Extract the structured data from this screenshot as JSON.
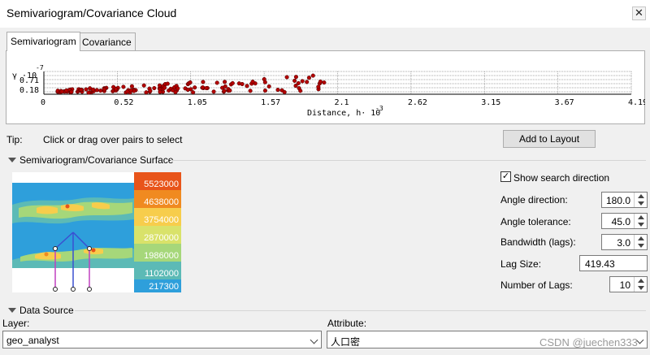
{
  "window": {
    "title": "Semivariogram/Covariance Cloud",
    "close_glyph": "✕"
  },
  "tabs": [
    {
      "label": "Semivariogram",
      "active": true
    },
    {
      "label": "Covariance",
      "active": false
    }
  ],
  "cloud_chart": {
    "y_unit": "γ ·10",
    "y_exp": "-7",
    "y_ticks": [
      "0.71",
      "0.18"
    ],
    "x_ticks": [
      "0",
      "0.52",
      "1.05",
      "1.57",
      "2.1",
      "2.62",
      "3.15",
      "3.67",
      "4.19"
    ],
    "x_label": "Distance, h· 10",
    "x_exp": "-3",
    "point_color": "#b40000"
  },
  "tip": {
    "label": "Tip:",
    "text": "Click or drag over pairs to select"
  },
  "add_to_layout": "Add to Layout",
  "surface_section": {
    "title": "Semivariogram/Covariance Surface",
    "legend": [
      {
        "value": "5523000",
        "color": "#e8541a"
      },
      {
        "value": "4638000",
        "color": "#f08a20"
      },
      {
        "value": "3754000",
        "color": "#f7cd4c"
      },
      {
        "value": "2870000",
        "color": "#d9e26a"
      },
      {
        "value": "1986000",
        "color": "#a6d77a"
      },
      {
        "value": "1102000",
        "color": "#5cbab6"
      },
      {
        "value": "217300",
        "color": "#2e9fdb"
      }
    ]
  },
  "controls": {
    "show_search_direction": {
      "label": "Show search direction",
      "checked_glyph": "✓"
    },
    "angle_direction": {
      "label": "Angle direction:",
      "value": "180.0"
    },
    "angle_tolerance": {
      "label": "Angle tolerance:",
      "value": "45.0"
    },
    "bandwidth": {
      "label": "Bandwidth (lags):",
      "value": "3.0"
    },
    "lag_size": {
      "label": "Lag Size:",
      "value": "419.43"
    },
    "number_of_lags": {
      "label": "Number of Lags:",
      "value": "10"
    }
  },
  "data_source": {
    "title": "Data Source",
    "layer_label": "Layer:",
    "layer_value": "geo_analyst",
    "attribute_label": "Attribute:",
    "attribute_value": "人口密"
  },
  "watermark": "CSDN @juechen333"
}
